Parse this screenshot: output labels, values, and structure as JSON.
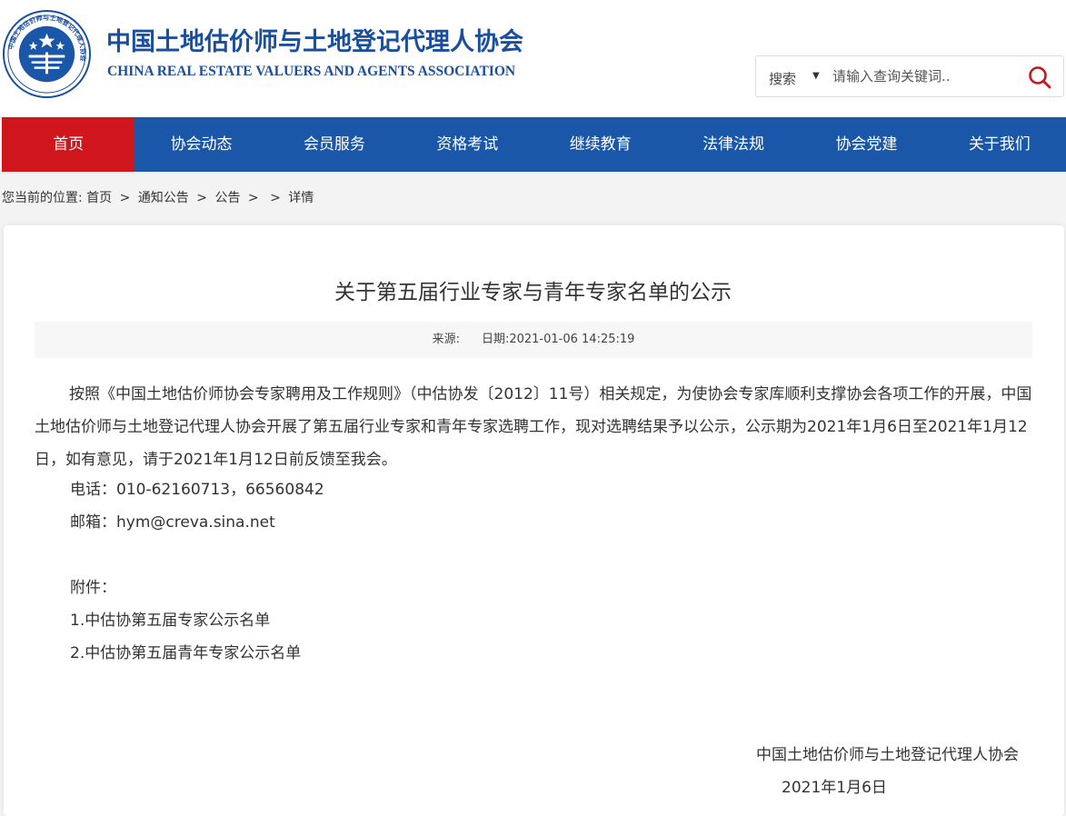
{
  "header": {
    "org_name_cn": "中国土地估价师与土地登记代理人协会",
    "org_name_en": "CHINA REAL ESTATE VALUERS AND AGENTS ASSOCIATION",
    "logo_icon": "association-emblem-icon",
    "logo_ring_text": "中国土地估价师与土地登记代理人协会"
  },
  "search": {
    "scope": "搜索",
    "placeholder": "请输入查询关键词.."
  },
  "nav": {
    "items": [
      {
        "label": "首页",
        "active": true
      },
      {
        "label": "协会动态"
      },
      {
        "label": "会员服务"
      },
      {
        "label": "资格考试"
      },
      {
        "label": "继续教育"
      },
      {
        "label": "法律法规"
      },
      {
        "label": "协会党建"
      },
      {
        "label": "关于我们"
      }
    ]
  },
  "breadcrumb": {
    "prefix": "您当前的位置:",
    "items": [
      "首页",
      "通知公告",
      "公告",
      "",
      "详情"
    ],
    "separator": ">"
  },
  "article": {
    "title": "关于第五届行业专家与青年专家名单的公示",
    "source_label": "来源:",
    "date_label": "日期:",
    "date_value": "2021-01-06 14:25:19",
    "paragraph": "按照《中国土地估价师协会专家聘用及工作规则》（中估协发〔2012〕11号）相关规定，为使协会专家库顺利支撑协会各项工作的开展，中国土地估价师与土地登记代理人协会开展了第五届行业专家和青年专家选聘工作，现对选聘结果予以公示，公示期为2021年1月6日至2021年1月12日，如有意见，请于2021年1月12日前反馈至我会。",
    "phone": "电话：010-62160713，66560842",
    "email": "邮箱：hym@creva.sina.net",
    "attachments_label": "附件：",
    "attachments": [
      "1.中估协第五届专家公示名单",
      "2.中估协第五届青年专家公示名单"
    ],
    "signature_org": "中国土地估价师与土地登记代理人协会",
    "signature_date": "2021年1月6日"
  },
  "colors": {
    "brand_blue": "#1a57a8",
    "active_red": "#d0161d",
    "title_blue": "#1a4f9e",
    "search_icon_red": "#c8161d"
  }
}
